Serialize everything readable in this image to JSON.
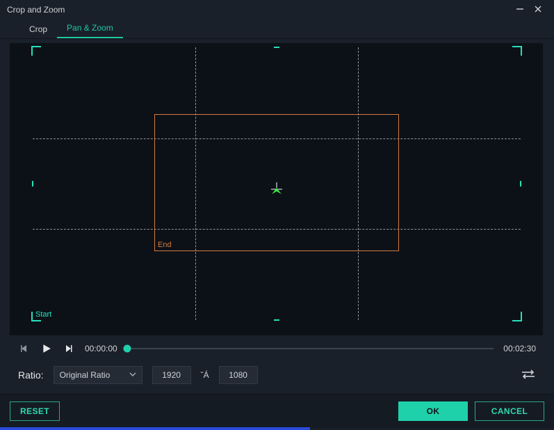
{
  "window": {
    "title": "Crop and Zoom"
  },
  "tabs": {
    "crop": "Crop",
    "pan_zoom": "Pan & Zoom",
    "active": "pan_zoom"
  },
  "selection": {
    "start_label": "Start",
    "end_label": "End"
  },
  "transport": {
    "current": "00:00:00",
    "total": "00:02:30"
  },
  "ratio": {
    "label": "Ratio:",
    "selected": "Original Ratio",
    "width": "1920",
    "separator": "ˇÁ",
    "height": "1080"
  },
  "buttons": {
    "reset": "RESET",
    "ok": "OK",
    "cancel": "CANCEL"
  },
  "colors": {
    "accent": "#1fd1ab",
    "end_frame": "#d47a3e"
  }
}
